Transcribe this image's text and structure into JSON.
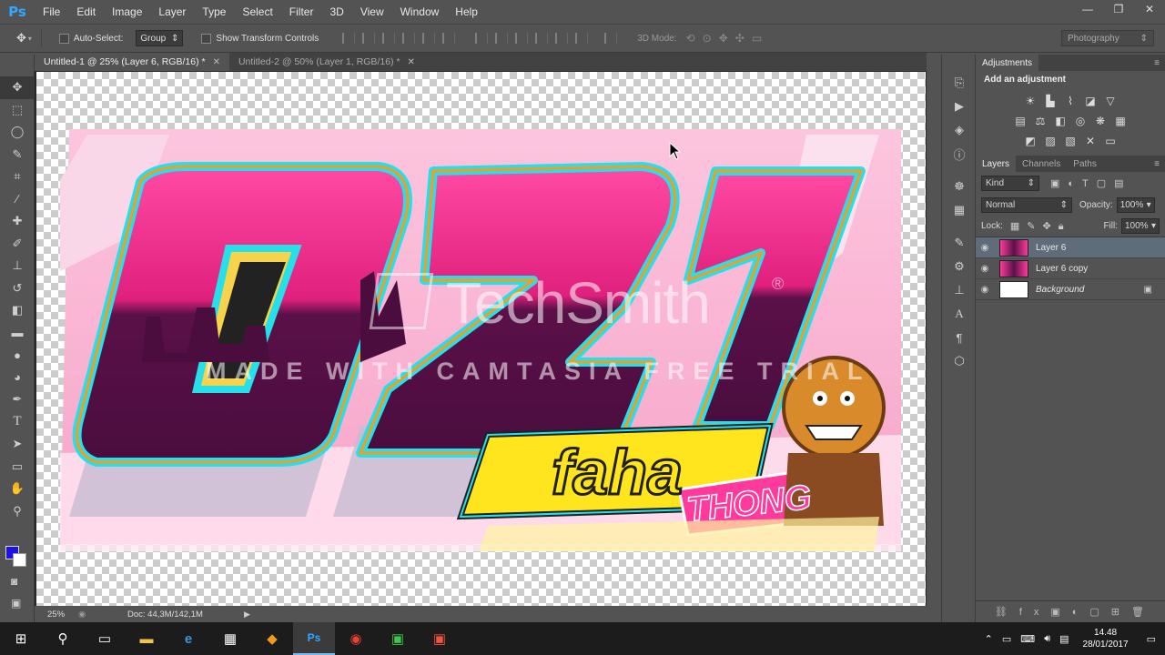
{
  "app": {
    "logo": "Ps"
  },
  "menu": [
    "File",
    "Edit",
    "Image",
    "Layer",
    "Type",
    "Select",
    "Filter",
    "3D",
    "View",
    "Window",
    "Help"
  ],
  "window_controls": [
    "—",
    "❐",
    "✕"
  ],
  "options": {
    "auto_select_label": "Auto-Select:",
    "auto_select_value": "Group",
    "show_transform_label": "Show Transform Controls",
    "mode_label": "3D Mode:",
    "workspace": "Photography"
  },
  "tabs": [
    {
      "label": "Untitled-1 @ 25% (Layer 6, RGB/16) *",
      "active": true
    },
    {
      "label": "Untitled-2 @ 50% (Layer 1, RGB/16) *",
      "active": false
    }
  ],
  "watermark": {
    "brand": "TechSmith",
    "registered": "®",
    "subtitle": "MADE WITH CAMTASIA FREE TRIAL"
  },
  "artwork": {
    "number": "021",
    "name_1": "faha",
    "name_2": "THONG"
  },
  "status": {
    "zoom": "25%",
    "doc": "Doc: 44,3M/142,1M"
  },
  "panels": {
    "adjustments_tab": "Adjustments",
    "add_adjustment": "Add an adjustment",
    "layer_tabs": [
      "Layers",
      "Channels",
      "Paths"
    ],
    "kind_label": "Kind",
    "blend_mode": "Normal",
    "opacity_label": "Opacity:",
    "opacity_value": "100%",
    "lock_label": "Lock:",
    "fill_label": "Fill:",
    "fill_value": "100%",
    "layers": [
      {
        "name": "Layer 6",
        "selected": true
      },
      {
        "name": "Layer 6 copy",
        "selected": false
      },
      {
        "name": "Background",
        "selected": false
      }
    ]
  },
  "taskbar": {
    "time": "14.48",
    "date": "28/01/2017"
  },
  "colors": {
    "foreground": "#1a12e8",
    "background": "#ffffff",
    "ui_base": "#535353"
  }
}
